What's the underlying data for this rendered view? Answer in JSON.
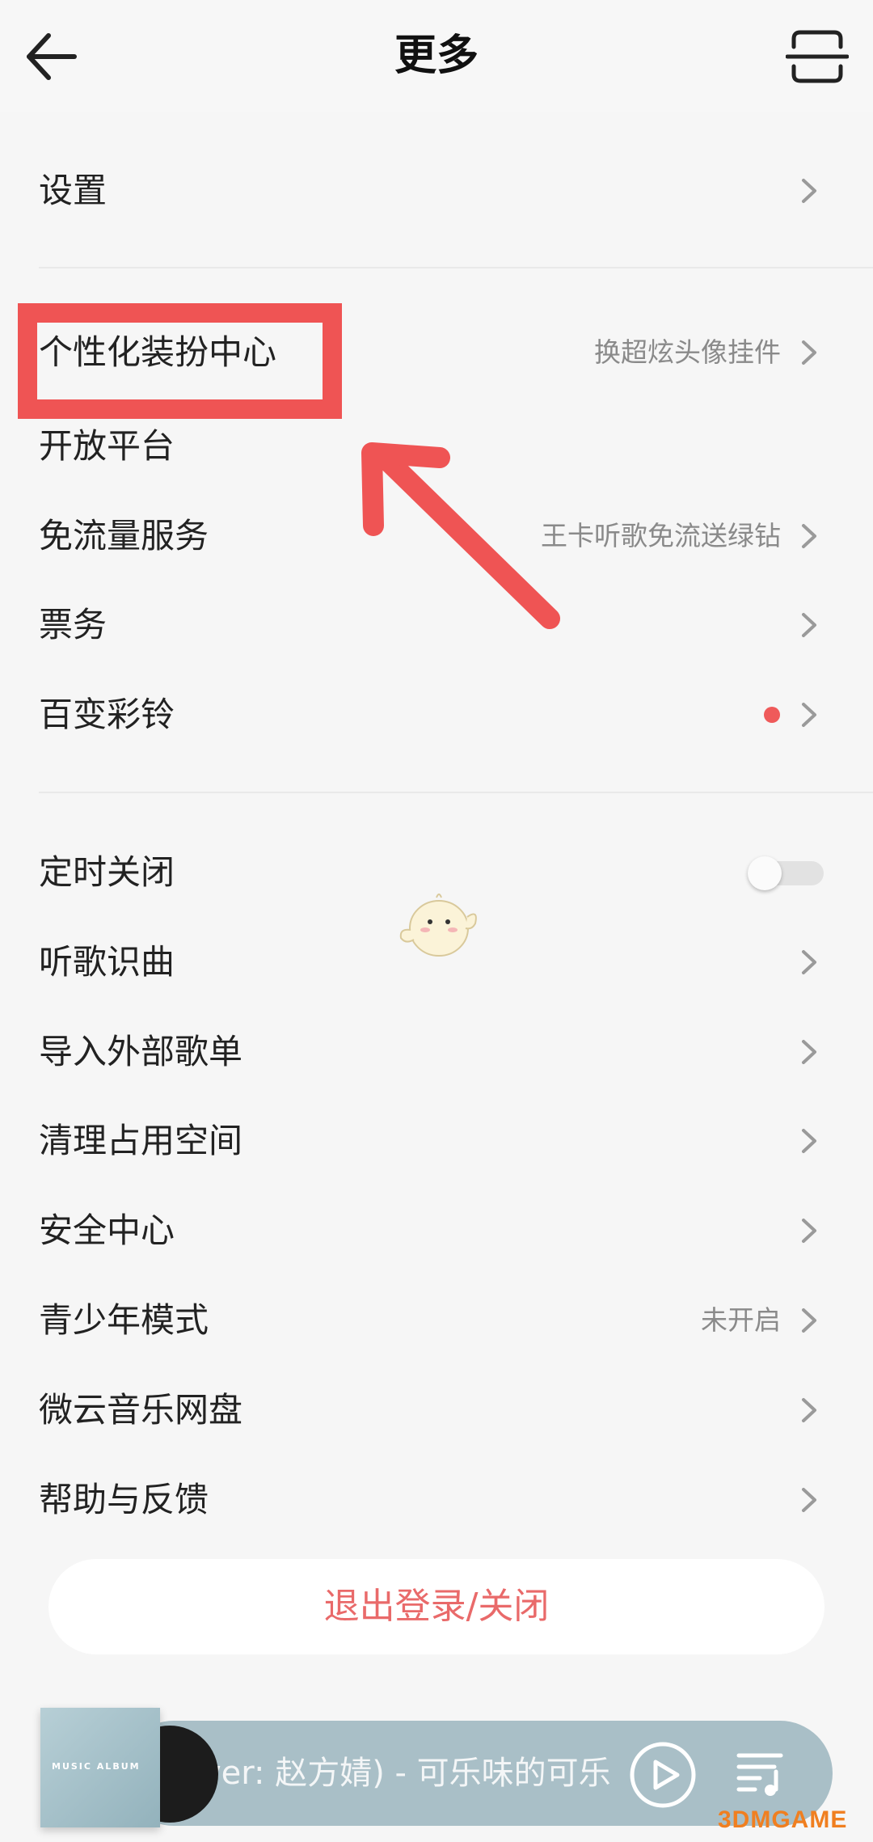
{
  "header": {
    "title": "更多",
    "back_icon": "arrow-left-icon",
    "scan_icon": "scan-icon"
  },
  "menu": {
    "settings": {
      "label": "设置"
    },
    "personalize": {
      "label": "个性化装扮中心",
      "sub": "换超炫头像挂件"
    },
    "open_platform": {
      "label": "开放平台"
    },
    "free_data": {
      "label": "免流量服务",
      "sub": "王卡听歌免流送绿钻"
    },
    "tickets": {
      "label": "票务"
    },
    "ringtone": {
      "label": "百变彩铃"
    },
    "sleep_timer": {
      "label": "定时关闭",
      "enabled": false
    },
    "song_recognition": {
      "label": "听歌识曲"
    },
    "import_playlist": {
      "label": "导入外部歌单"
    },
    "clear_storage": {
      "label": "清理占用空间"
    },
    "security": {
      "label": "安全中心"
    },
    "teen_mode": {
      "label": "青少年模式",
      "sub": "未开启"
    },
    "weiyun": {
      "label": "微云音乐网盘"
    },
    "help": {
      "label": "帮助与反馈"
    }
  },
  "logout_label": "退出登录/关闭",
  "player": {
    "song_title": "ver: 赵方婧) - 可乐味的可乐",
    "album_cover_text": "MUSIC ALBUM",
    "play_icon": "play-icon",
    "playlist_icon": "playlist-icon"
  },
  "watermark": "3DMGAME",
  "colors": {
    "accent_red": "#ef5454",
    "logout_text": "#e96a6a",
    "player_bg": "#a9bfc7"
  }
}
